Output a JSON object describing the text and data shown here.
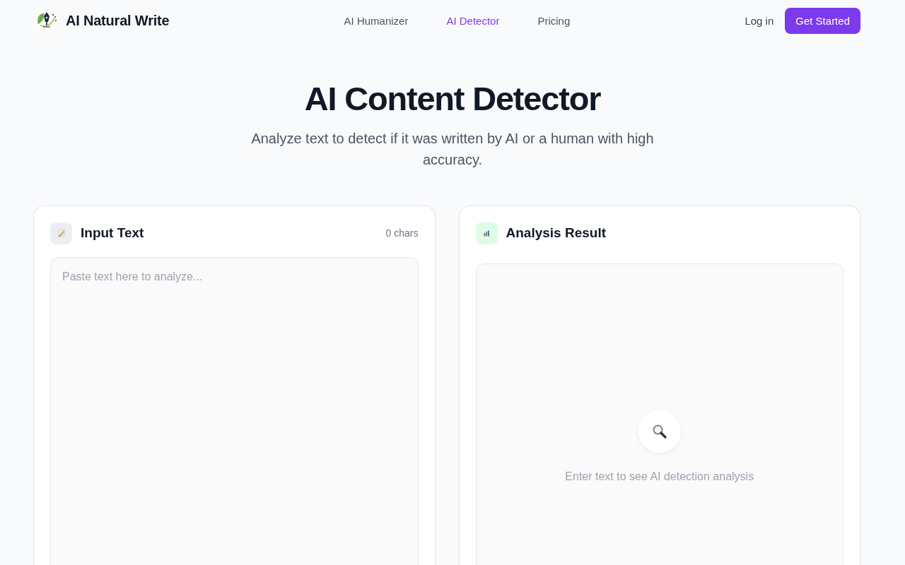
{
  "header": {
    "brand": "AI Natural Write",
    "nav": [
      {
        "label": "AI Humanizer",
        "selected": false
      },
      {
        "label": "AI Detector",
        "selected": true
      },
      {
        "label": "Pricing",
        "selected": false
      }
    ],
    "login": "Log in",
    "cta": "Get Started"
  },
  "hero": {
    "title": "AI Content Detector",
    "subtitle": "Analyze text to detect if it was written by AI or a human with high accuracy."
  },
  "input_panel": {
    "title": "Input Text",
    "char_count": "0 chars",
    "placeholder": "Paste text here to analyze..."
  },
  "result_panel": {
    "title": "Analysis Result",
    "empty_message": "Enter text to see AI detection analysis"
  }
}
